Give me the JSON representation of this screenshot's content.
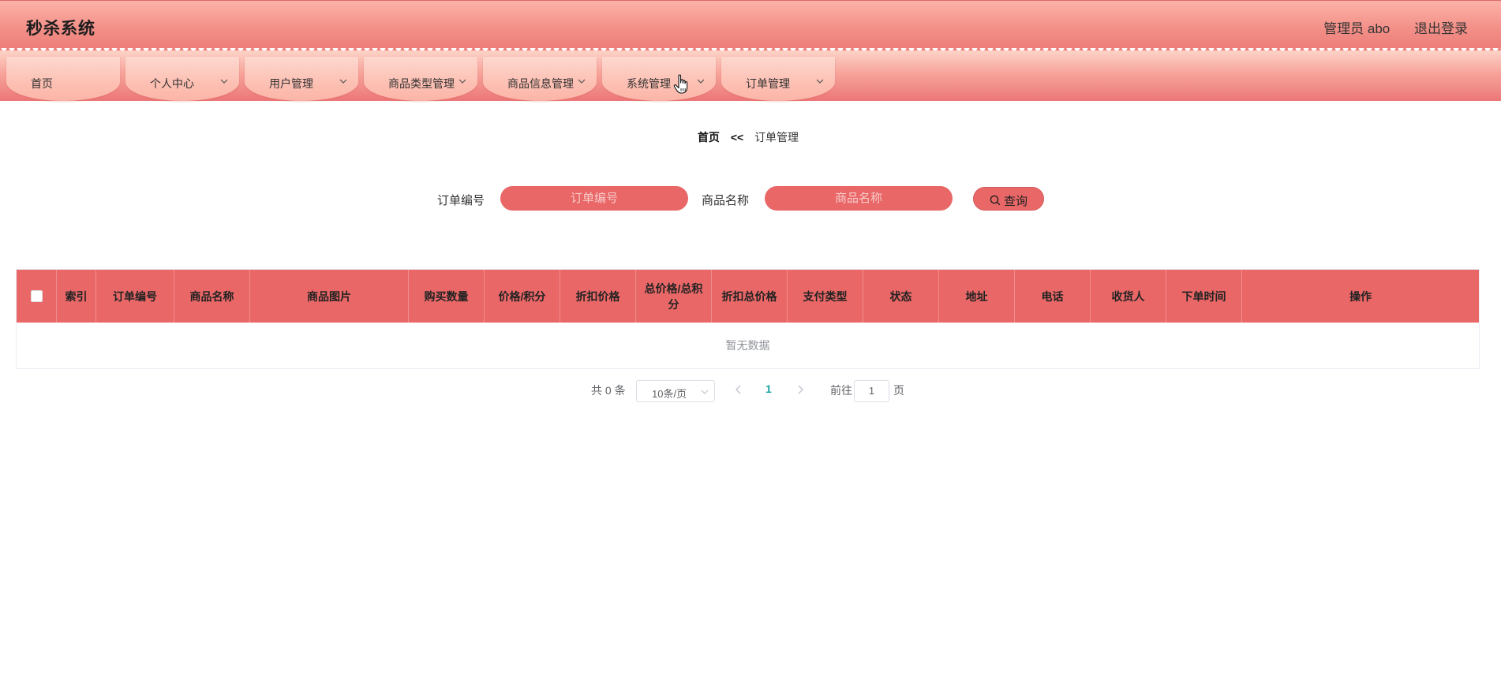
{
  "header": {
    "brand": "秒杀系统",
    "user": "管理员 abo",
    "logout": "退出登录"
  },
  "nav": {
    "items": [
      {
        "label": "首页",
        "has_dropdown": false
      },
      {
        "label": "个人中心",
        "has_dropdown": true
      },
      {
        "label": "用户管理",
        "has_dropdown": true
      },
      {
        "label": "商品类型管理",
        "has_dropdown": true
      },
      {
        "label": "商品信息管理",
        "has_dropdown": true
      },
      {
        "label": "系统管理",
        "has_dropdown": true
      },
      {
        "label": "订单管理",
        "has_dropdown": true
      }
    ]
  },
  "breadcrumb": {
    "home": "首页",
    "separator": "<<",
    "current": "订单管理"
  },
  "search": {
    "order_no_label": "订单编号",
    "order_no_placeholder": "订单编号",
    "product_name_label": "商品名称",
    "product_name_placeholder": "商品名称",
    "query_label": "查询"
  },
  "table": {
    "columns": [
      "索引",
      "订单编号",
      "商品名称",
      "商品图片",
      "购买数量",
      "价格/积分",
      "折扣价格",
      "总价格/总积分",
      "折扣总价格",
      "支付类型",
      "状态",
      "地址",
      "电话",
      "收货人",
      "下单时间",
      "操作"
    ],
    "rows": [],
    "empty_text": "暂无数据"
  },
  "pagination": {
    "total": "共 0 条",
    "page_size": "10条/页",
    "current_page": "1",
    "goto_label": "前往",
    "goto_value": "1",
    "page_suffix": "页"
  },
  "colors": {
    "accent": "#e96767",
    "header_top": "#fcb3a8",
    "nav_tab": "#fdc0b3",
    "active_page": "#1aa3a3"
  },
  "icons": {
    "dropdown": "chevron-down-icon",
    "search": "search-icon",
    "pointer": "hand-pointer-icon"
  }
}
